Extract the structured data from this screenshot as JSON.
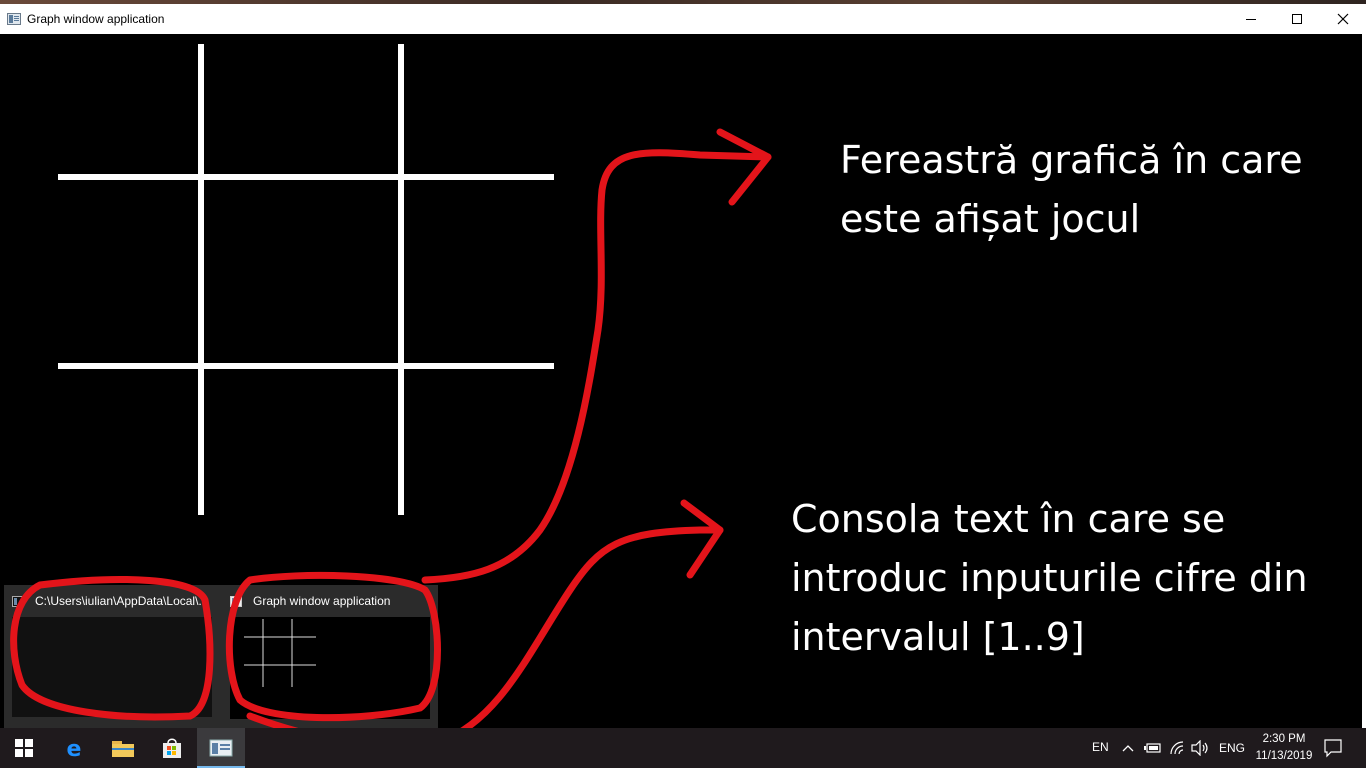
{
  "window": {
    "title": "Graph window application",
    "controls": {
      "minimize": "—",
      "maximize": "☐",
      "close": "✕"
    }
  },
  "annotations": {
    "graphic_window_caption": "Fereastră grafică în care\neste afișat jocul",
    "console_caption": "Consola text în care se\nintroduc inputurile cifre din\nintervalul [1..9]",
    "highlight_color": "#e3141a"
  },
  "game_board": {
    "type": "tic-tac-toe grid",
    "line_color": "#ffffff"
  },
  "taskbar_previews": [
    {
      "title": "C:\\Users\\iulian\\AppData\\Local\\...",
      "icon": "console-window-icon"
    },
    {
      "title": "Graph window application",
      "icon": "graph-window-icon"
    }
  ],
  "taskbar": {
    "pinned": [
      {
        "name": "start-button",
        "icon": "windows-logo-icon"
      },
      {
        "name": "edge",
        "icon": "edge-icon"
      },
      {
        "name": "file-explorer",
        "icon": "folder-icon"
      },
      {
        "name": "store",
        "icon": "store-icon"
      },
      {
        "name": "graph-window",
        "icon": "graph-window-icon"
      }
    ],
    "tray": {
      "language_indicator": "EN",
      "input_language": "ENG",
      "time": "2:30 PM",
      "date": "11/13/2019"
    }
  }
}
